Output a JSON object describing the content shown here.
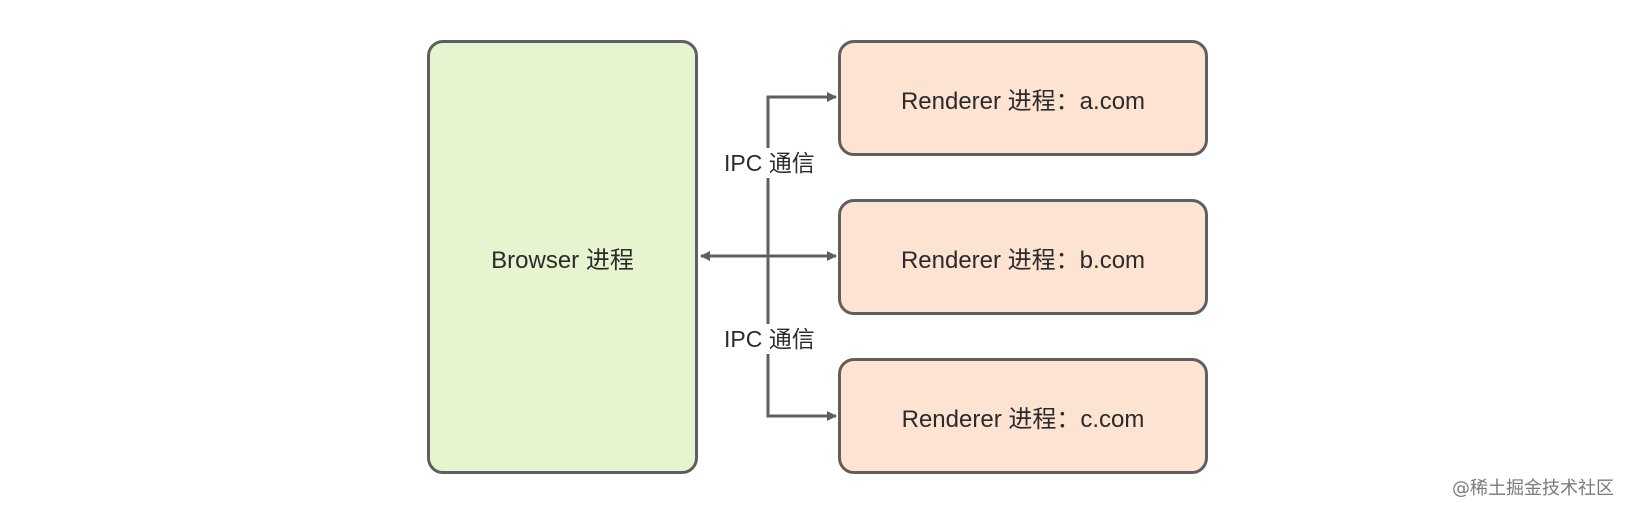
{
  "diagram": {
    "browser": {
      "label": "Browser 进程"
    },
    "renderers": [
      {
        "label": "Renderer 进程：a.com"
      },
      {
        "label": "Renderer 进程：b.com"
      },
      {
        "label": "Renderer 进程：c.com"
      }
    ],
    "ipc_labels": [
      "IPC 通信",
      "IPC 通信"
    ]
  },
  "colors": {
    "browser_fill": "#e6f5cf",
    "renderer_fill": "#fde3d1",
    "stroke": "#5f5f5f"
  },
  "watermark": "@稀土掘金技术社区"
}
